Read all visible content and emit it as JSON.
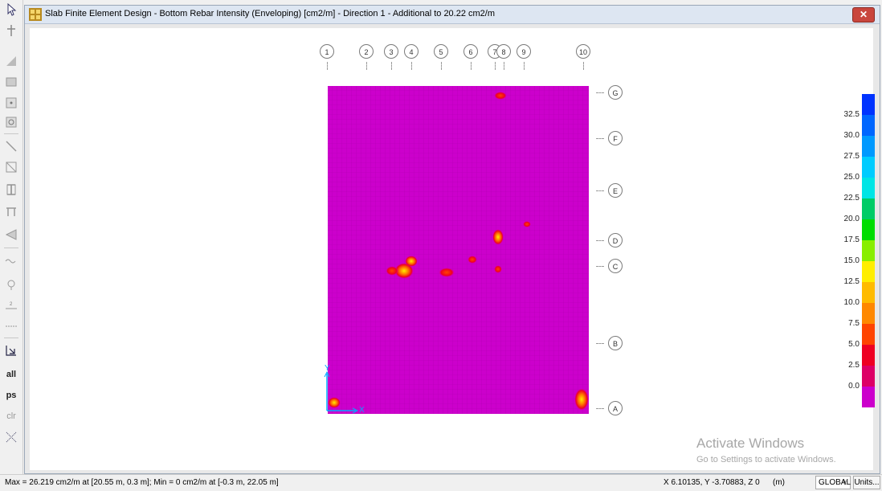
{
  "window": {
    "title": "Slab Finite Element Design - Bottom Rebar Intensity (Enveloping) [cm2/m] - Direction 1 - Additional to 20.22 cm2/m",
    "close_label": "✕"
  },
  "grid": {
    "columns": [
      "1",
      "2",
      "3",
      "4",
      "5",
      "6",
      "7",
      "8",
      "9",
      "10"
    ],
    "rows": [
      "G",
      "F",
      "E",
      "D",
      "C",
      "B",
      "A"
    ]
  },
  "axes": {
    "y_label": "Y",
    "x_label": "X"
  },
  "legend": {
    "labels": [
      "32.5",
      "30.0",
      "27.5",
      "25.0",
      "22.5",
      "20.0",
      "17.5",
      "15.0",
      "12.5",
      "10.0",
      "7.5",
      "5.0",
      "2.5",
      "0.0"
    ],
    "colors": [
      "#0033ff",
      "#0066ff",
      "#0099ff",
      "#00ccff",
      "#00e5e5",
      "#00cc66",
      "#00dd00",
      "#88ee00",
      "#ffee00",
      "#ffbb00",
      "#ff8800",
      "#ff4400",
      "#ee0022",
      "#dd0066",
      "#cc00cc"
    ]
  },
  "toolbar": {
    "icons": [
      "pointer-icon",
      "move-icon",
      "area-icon",
      "rectangle-icon",
      "node-icon",
      "circle-node-icon",
      "line-icon",
      "diagonal-icon",
      "column-icon",
      "frame-icon",
      "wall-icon",
      "spring-icon",
      "joint-icon",
      "dimension-icon",
      "grid-icon",
      "section-cut-icon"
    ],
    "text_buttons": [
      "all",
      "ps",
      "clr"
    ]
  },
  "watermark": {
    "title": "Activate Windows",
    "subtitle": "Go to Settings to activate Windows."
  },
  "status": {
    "left": "Max = 26.219 cm2/m at [20.55 m, 0.3 m];  Min = 0 cm2/m at [-0.3 m, 22.05 m]",
    "coords": "X 6.10135,  Y -3.70883,  Z 0",
    "units_label": "(m)",
    "coord_system": "GLOBAL",
    "units_button": "Units..."
  }
}
